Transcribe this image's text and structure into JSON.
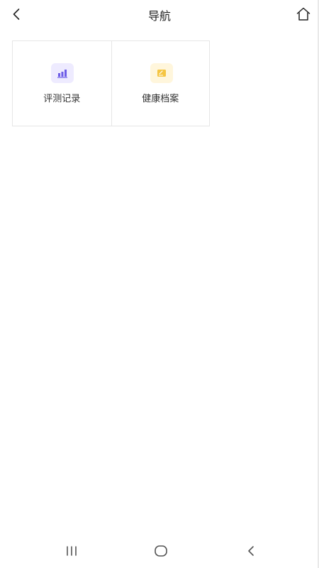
{
  "header": {
    "title": "导航",
    "back_icon": "chevron-left-icon",
    "home_icon": "home-icon"
  },
  "grid": {
    "items": [
      {
        "label": "评测记录",
        "icon": "bar-chart-icon",
        "accent": "#6c5ce7"
      },
      {
        "label": "健康档案",
        "icon": "document-icon",
        "accent": "#f5c542"
      }
    ]
  },
  "system_nav": {
    "recent_icon": "recent-apps-icon",
    "home_icon": "home-circle-icon",
    "back_icon": "back-chevron-icon"
  }
}
